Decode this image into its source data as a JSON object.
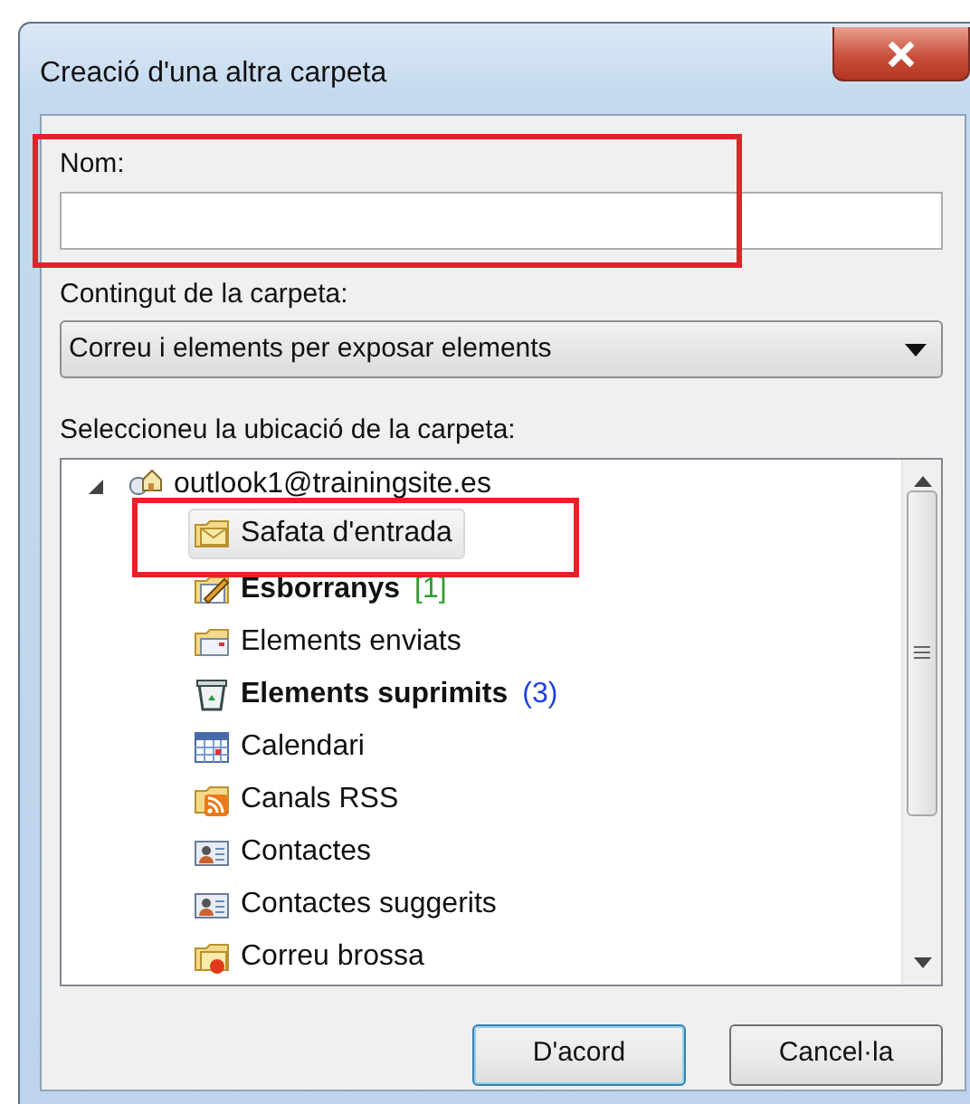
{
  "window": {
    "title": "Creació d'una altra carpeta"
  },
  "name_field": {
    "label": "Nom:",
    "highlighted": true
  },
  "content_field": {
    "label": "Contingut de la carpeta:",
    "value": "Correu i elements per exposar elements"
  },
  "location": {
    "label": "Seleccioneu la ubicació de la carpeta:",
    "tree": [
      {
        "kind": "account",
        "label": "outlook1@trainingsite.es",
        "expanded": true,
        "selected": false,
        "highlighted": false,
        "bold": false,
        "children": [
          {
            "kind": "inbox",
            "label": "Safata d'entrada",
            "selected": true,
            "highlighted": true,
            "bold": false
          },
          {
            "kind": "drafts",
            "label": "Esborranys",
            "count": "[1]",
            "color": "#2e9e2e",
            "selected": false,
            "highlighted": false,
            "bold": true
          },
          {
            "kind": "sent",
            "label": "Elements enviats",
            "selected": false,
            "highlighted": false,
            "bold": false
          },
          {
            "kind": "deleted",
            "label": "Elements suprimits",
            "count": "(3)",
            "color": "#1f3fe0",
            "selected": false,
            "highlighted": false,
            "bold": true
          },
          {
            "kind": "calendar",
            "label": "Calendari",
            "selected": false,
            "highlighted": false,
            "bold": false
          },
          {
            "kind": "rss",
            "label": "Canals RSS",
            "selected": false,
            "highlighted": false,
            "bold": false
          },
          {
            "kind": "contacts",
            "label": "Contactes",
            "selected": false,
            "highlighted": false,
            "bold": false
          },
          {
            "kind": "contacts",
            "label": "Contactes suggerits",
            "selected": false,
            "highlighted": false,
            "bold": false
          },
          {
            "kind": "junk",
            "label": "Correu brossa",
            "selected": false,
            "highlighted": false,
            "bold": false
          }
        ]
      }
    ]
  },
  "buttons": [
    {
      "label": "D'acord",
      "default": true
    },
    {
      "label": "Cancel·la",
      "default": false
    }
  ]
}
